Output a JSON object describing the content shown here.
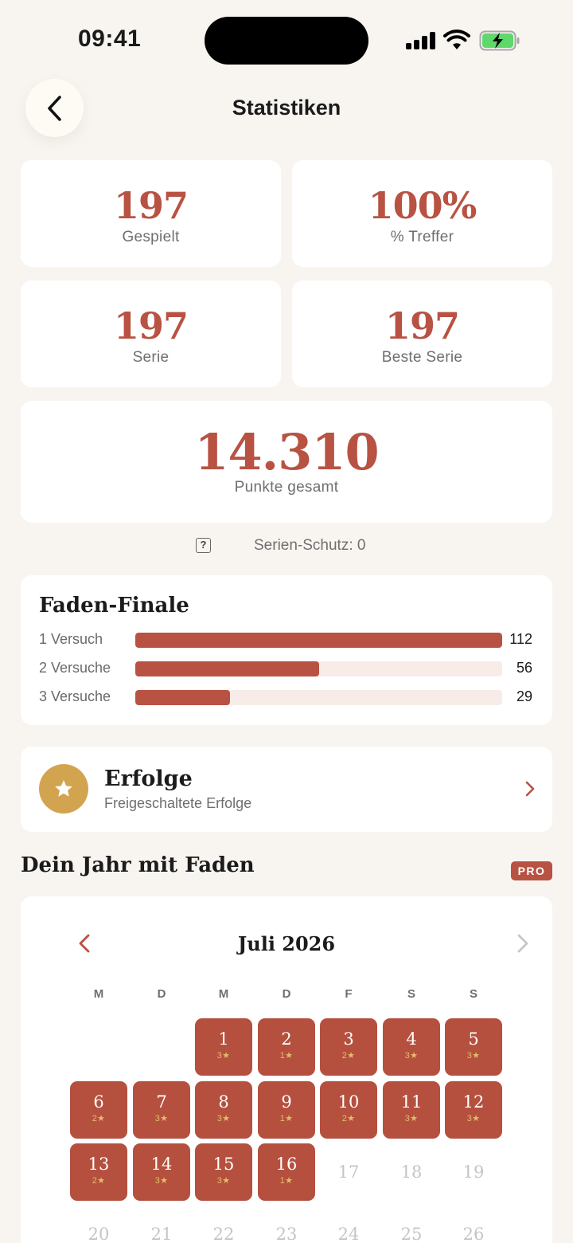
{
  "status": {
    "time": "09:41"
  },
  "header": {
    "title": "Statistiken"
  },
  "stats": {
    "played": {
      "value": "197",
      "label": "Gespielt"
    },
    "hit_rate": {
      "value": "100%",
      "label": "% Treffer"
    },
    "streak": {
      "value": "197",
      "label": "Serie"
    },
    "best_streak": {
      "value": "197",
      "label": "Beste Serie"
    },
    "total_points": {
      "value": "14.310",
      "label": "Punkte gesamt"
    }
  },
  "streak_protection": {
    "help": "?",
    "text": "Serien-Schutz: 0"
  },
  "distribution": {
    "title": "Faden-Finale",
    "rows": [
      {
        "label": "1 Versuch",
        "count": "112",
        "value": 112
      },
      {
        "label": "2 Versuche",
        "count": "56",
        "value": 56
      },
      {
        "label": "3 Versuche",
        "count": "29",
        "value": 29
      }
    ],
    "max": 112
  },
  "achievements": {
    "title": "Erfolge",
    "subtitle": "Freigeschaltete Erfolge",
    "icon": "star-icon"
  },
  "year": {
    "title": "Dein Jahr mit Faden",
    "badge": "PRO"
  },
  "calendar": {
    "month": "Juli 2026",
    "weekdays": [
      "M",
      "D",
      "M",
      "D",
      "F",
      "S",
      "S"
    ],
    "days": [
      {
        "day": "1",
        "stars": "3★"
      },
      {
        "day": "2",
        "stars": "1★"
      },
      {
        "day": "3",
        "stars": "2★"
      },
      {
        "day": "4",
        "stars": "3★"
      },
      {
        "day": "5",
        "stars": "3★"
      },
      {
        "day": "6",
        "stars": "2★"
      },
      {
        "day": "7",
        "stars": "3★"
      },
      {
        "day": "8",
        "stars": "3★"
      },
      {
        "day": "9",
        "stars": "1★"
      },
      {
        "day": "10",
        "stars": "2★"
      },
      {
        "day": "11",
        "stars": "3★"
      },
      {
        "day": "12",
        "stars": "3★"
      },
      {
        "day": "13",
        "stars": "2★"
      },
      {
        "day": "14",
        "stars": "3★"
      },
      {
        "day": "15",
        "stars": "3★"
      },
      {
        "day": "16",
        "stars": "1★"
      },
      {
        "day": "17",
        "stars": ""
      },
      {
        "day": "18",
        "stars": ""
      },
      {
        "day": "19",
        "stars": ""
      },
      {
        "day": "20",
        "stars": ""
      },
      {
        "day": "21",
        "stars": ""
      },
      {
        "day": "22",
        "stars": ""
      },
      {
        "day": "23",
        "stars": ""
      },
      {
        "day": "24",
        "stars": ""
      },
      {
        "day": "25",
        "stars": ""
      },
      {
        "day": "26",
        "stars": ""
      }
    ]
  },
  "colors": {
    "accent": "#b85243",
    "background": "#f8f5f1",
    "gold": "#d3a450",
    "star": "#e2bd6a"
  }
}
